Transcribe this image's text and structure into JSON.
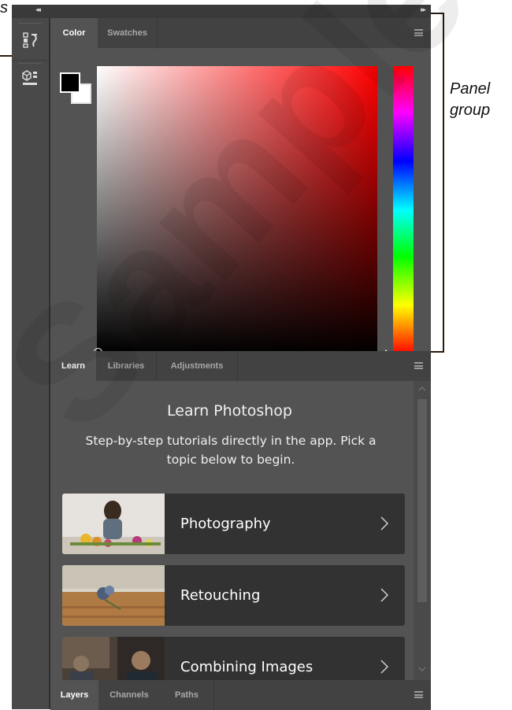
{
  "callouts": {
    "left_fragment": "s",
    "right_line1": "Panel",
    "right_line2": "group"
  },
  "watermark": {
    "text": "Sample"
  },
  "dock": {
    "collapse_left": "◂◂",
    "collapse_right": "▸▸",
    "strip_icons": [
      "history-icon",
      "3d-icon"
    ]
  },
  "color_panel": {
    "tabs": [
      {
        "label": "Color",
        "active": true
      },
      {
        "label": "Swatches",
        "active": false
      }
    ],
    "foreground_color": "#000000",
    "background_color": "#ffffff",
    "base_hue": "#ff0000"
  },
  "learn_panel": {
    "tabs": [
      {
        "label": "Learn",
        "active": true
      },
      {
        "label": "Libraries",
        "active": false
      },
      {
        "label": "Adjustments",
        "active": false
      }
    ],
    "title": "Learn Photoshop",
    "subtitle_line1": "Step-by-step tutorials directly in the app. Pick a",
    "subtitle_line2": "topic below to begin.",
    "tutorials": [
      {
        "label": "Photography"
      },
      {
        "label": "Retouching"
      },
      {
        "label": "Combining Images"
      }
    ]
  },
  "layers_panel": {
    "tabs": [
      {
        "label": "Layers",
        "active": true
      },
      {
        "label": "Channels",
        "active": false
      },
      {
        "label": "Paths",
        "active": false
      }
    ]
  }
}
